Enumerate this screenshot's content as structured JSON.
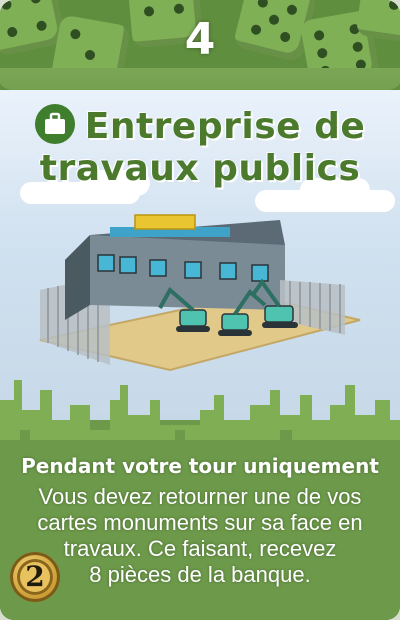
{
  "card": {
    "cost": "4",
    "title_line1": "Entreprise de",
    "title_line2": "travaux publics",
    "icon": "briefcase-icon",
    "activation": "Pendant votre tour uniquement",
    "effect_lines": [
      "Vous devez retourner une de vos",
      "cartes monuments sur sa face en",
      "travaux. Ce faisant, recevez",
      "8 pièces de la banque."
    ],
    "coin_value": "2"
  },
  "colors": {
    "card_green": "#6d9a4a",
    "title_green": "#4b7a2d",
    "text_white": "#ffffff"
  }
}
